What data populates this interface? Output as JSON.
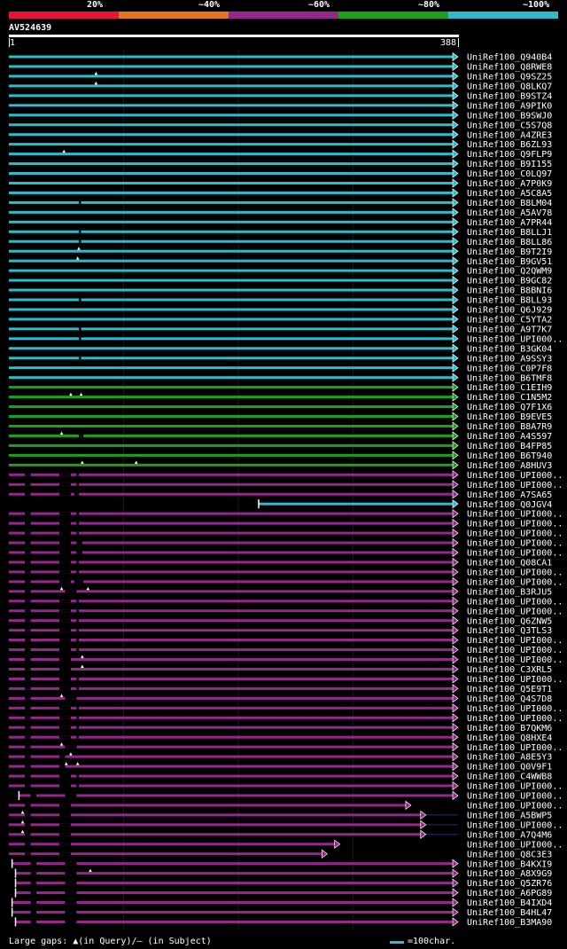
{
  "legend": {
    "segments": [
      {
        "color": "#e6143c"
      },
      {
        "color": "#e6731e"
      },
      {
        "color": "#96288c"
      },
      {
        "color": "#1ea01e"
      },
      {
        "color": "#2cbccc"
      }
    ],
    "labels": [
      "20%",
      "~40%",
      "~60%",
      "~80%",
      "~100%"
    ]
  },
  "query": {
    "name": "AV524639",
    "start": "1",
    "end": "388",
    "length": 388
  },
  "colors": {
    "cyan": "#2cbccc",
    "green": "#1ea01e",
    "purple": "#96288c",
    "query": "#ffffff",
    "insert": "#ffffc8"
  },
  "hits": [
    {
      "label": "UniRef100_Q940B4",
      "c": "cyan",
      "s": 1,
      "e": 388
    },
    {
      "label": "UniRef100_Q8RWE8",
      "c": "cyan",
      "s": 1,
      "e": 388
    },
    {
      "label": "UniRef100_Q9SZ25",
      "c": "cyan",
      "s": 1,
      "e": 388,
      "ins": [
        77
      ]
    },
    {
      "label": "UniRef100_Q8LKQ7",
      "c": "cyan",
      "s": 1,
      "e": 388,
      "ins": [
        77
      ]
    },
    {
      "label": "UniRef100_B9STZ4",
      "c": "cyan",
      "s": 1,
      "e": 388
    },
    {
      "label": "UniRef100_A9PIK0",
      "c": "cyan",
      "s": 1,
      "e": 388
    },
    {
      "label": "UniRef100_B9SWJ0",
      "c": "cyan",
      "s": 1,
      "e": 388
    },
    {
      "label": "UniRef100_C5S7Q8",
      "c": "cyan",
      "s": 1,
      "e": 388
    },
    {
      "label": "UniRef100_A4ZRE3",
      "c": "cyan",
      "s": 1,
      "e": 388
    },
    {
      "label": "UniRef100_B6ZL93",
      "c": "cyan",
      "s": 1,
      "e": 388
    },
    {
      "label": "UniRef100_Q9FLP9",
      "c": "cyan",
      "s": 1,
      "e": 388,
      "ins": [
        49
      ]
    },
    {
      "label": "UniRef100_B9I155",
      "c": "cyan",
      "s": 1,
      "e": 388
    },
    {
      "label": "UniRef100_C0LQ97",
      "c": "cyan",
      "s": 1,
      "e": 388
    },
    {
      "label": "UniRef100_A7P0K9",
      "c": "cyan",
      "s": 1,
      "e": 388
    },
    {
      "label": "UniRef100_A5C8A5",
      "c": "cyan",
      "s": 1,
      "e": 388
    },
    {
      "label": "UniRef100_B8LM04",
      "c": "cyan",
      "s": 1,
      "e": 388,
      "gaps": [
        [
          62,
          64
        ]
      ]
    },
    {
      "label": "UniRef100_A5AV78",
      "c": "cyan",
      "s": 1,
      "e": 388
    },
    {
      "label": "UniRef100_A7PR44",
      "c": "cyan",
      "s": 1,
      "e": 388
    },
    {
      "label": "UniRef100_B8LLJ1",
      "c": "cyan",
      "s": 1,
      "e": 388,
      "gaps": [
        [
          62,
          64
        ]
      ]
    },
    {
      "label": "UniRef100_B8LL86",
      "c": "cyan",
      "s": 1,
      "e": 388,
      "gaps": [
        [
          62,
          64
        ]
      ]
    },
    {
      "label": "UniRef100_B9T2I9",
      "c": "cyan",
      "s": 1,
      "e": 388,
      "ins": [
        62
      ]
    },
    {
      "label": "UniRef100_B9GV51",
      "c": "cyan",
      "s": 1,
      "e": 388,
      "ins": [
        61
      ]
    },
    {
      "label": "UniRef100_Q2QWM9",
      "c": "cyan",
      "s": 1,
      "e": 388
    },
    {
      "label": "UniRef100_B9GC82",
      "c": "cyan",
      "s": 1,
      "e": 388
    },
    {
      "label": "UniRef100_B8BNI6",
      "c": "cyan",
      "s": 1,
      "e": 388
    },
    {
      "label": "UniRef100_B8LL93",
      "c": "cyan",
      "s": 1,
      "e": 388,
      "gaps": [
        [
          62,
          64
        ]
      ]
    },
    {
      "label": "UniRef100_Q6J929",
      "c": "cyan",
      "s": 1,
      "e": 388
    },
    {
      "label": "UniRef100_C5YTA2",
      "c": "cyan",
      "s": 1,
      "e": 388
    },
    {
      "label": "UniRef100_A9T7K7",
      "c": "cyan",
      "s": 1,
      "e": 388,
      "gaps": [
        [
          62,
          64
        ]
      ]
    },
    {
      "label": "UniRef100_UPI000..",
      "c": "cyan",
      "s": 1,
      "e": 388,
      "gaps": [
        [
          62,
          64
        ]
      ]
    },
    {
      "label": "UniRef100_B3GK04",
      "c": "cyan",
      "s": 1,
      "e": 388
    },
    {
      "label": "UniRef100_A9SSY3",
      "c": "cyan",
      "s": 1,
      "e": 388,
      "gaps": [
        [
          62,
          64
        ]
      ]
    },
    {
      "label": "UniRef100_C0P7F8",
      "c": "cyan",
      "s": 1,
      "e": 388
    },
    {
      "label": "UniRef100_B6TMF8",
      "c": "cyan",
      "s": 1,
      "e": 388
    },
    {
      "label": "UniRef100_C1EIH9",
      "c": "green",
      "s": 1,
      "e": 388
    },
    {
      "label": "UniRef100_C1N5M2",
      "c": "green",
      "s": 1,
      "e": 388,
      "ins": [
        55,
        64
      ]
    },
    {
      "label": "UniRef100_Q7F1X6",
      "c": "green",
      "s": 1,
      "e": 388
    },
    {
      "label": "UniRef100_B9EVE5",
      "c": "green",
      "s": 1,
      "e": 388
    },
    {
      "label": "UniRef100_B8A7R9",
      "c": "green",
      "s": 1,
      "e": 388
    },
    {
      "label": "UniRef100_A4S597",
      "c": "green",
      "s": 1,
      "e": 388,
      "ins": [
        47
      ],
      "gaps": [
        [
          62,
          66
        ]
      ]
    },
    {
      "label": "UniRef100_B4FP85",
      "c": "green",
      "s": 1,
      "e": 388
    },
    {
      "label": "UniRef100_B6T940",
      "c": "green",
      "s": 1,
      "e": 388
    },
    {
      "label": "UniRef100_A8HUV3",
      "c": "green",
      "s": 1,
      "e": 388,
      "ins": [
        65,
        112
      ]
    },
    {
      "label": "UniRef100_UPI000..",
      "c": "purple",
      "s": 1,
      "e": 388,
      "gaps": [
        [
          15,
          20
        ],
        [
          45,
          55
        ],
        [
          60,
          62
        ]
      ]
    },
    {
      "label": "UniRef100_UPI000..",
      "c": "purple",
      "s": 1,
      "e": 388,
      "gaps": [
        [
          15,
          20
        ],
        [
          45,
          55
        ],
        [
          60,
          62
        ]
      ]
    },
    {
      "label": "UniRef100_A7SA65",
      "c": "purple",
      "s": 1,
      "e": 388,
      "gaps": [
        [
          15,
          20
        ],
        [
          45,
          55
        ],
        [
          58,
          62
        ]
      ]
    },
    {
      "label": "UniRef100_Q0JGV4",
      "c": "cyan",
      "s": 219,
      "e": 388,
      "tick": true
    },
    {
      "label": "UniRef100_UPI000..",
      "c": "purple",
      "s": 1,
      "e": 388,
      "gaps": [
        [
          15,
          20
        ],
        [
          45,
          55
        ],
        [
          60,
          62
        ]
      ]
    },
    {
      "label": "UniRef100_UPI000..",
      "c": "purple",
      "s": 1,
      "e": 388,
      "gaps": [
        [
          15,
          20
        ],
        [
          45,
          55
        ],
        [
          60,
          62
        ]
      ]
    },
    {
      "label": "UniRef100_UPI000..",
      "c": "purple",
      "s": 1,
      "e": 388,
      "gaps": [
        [
          15,
          20
        ],
        [
          45,
          55
        ],
        [
          60,
          62
        ]
      ]
    },
    {
      "label": "UniRef100_UPI000..",
      "c": "purple",
      "s": 1,
      "e": 388,
      "gaps": [
        [
          15,
          20
        ],
        [
          45,
          55
        ],
        [
          60,
          65
        ]
      ]
    },
    {
      "label": "UniRef100_UPI000..",
      "c": "purple",
      "s": 1,
      "e": 388,
      "gaps": [
        [
          15,
          20
        ],
        [
          45,
          55
        ],
        [
          60,
          65
        ]
      ]
    },
    {
      "label": "UniRef100_Q08CA1",
      "c": "purple",
      "s": 1,
      "e": 388,
      "gaps": [
        [
          15,
          20
        ],
        [
          45,
          55
        ],
        [
          60,
          62
        ]
      ]
    },
    {
      "label": "UniRef100_UPI000..",
      "c": "purple",
      "s": 1,
      "e": 388,
      "gaps": [
        [
          15,
          20
        ],
        [
          45,
          55
        ],
        [
          60,
          62
        ]
      ]
    },
    {
      "label": "UniRef100_UPI000..",
      "c": "purple",
      "s": 1,
      "e": 388,
      "gaps": [
        [
          15,
          20
        ],
        [
          45,
          55
        ],
        [
          58,
          66
        ]
      ]
    },
    {
      "label": "UniRef100_B3RJU5",
      "c": "purple",
      "s": 1,
      "e": 388,
      "ins": [
        47,
        70
      ],
      "gaps": [
        [
          15,
          20
        ],
        [
          50,
          60
        ]
      ]
    },
    {
      "label": "UniRef100_UPI000..",
      "c": "purple",
      "s": 1,
      "e": 388,
      "gaps": [
        [
          15,
          20
        ],
        [
          45,
          55
        ],
        [
          60,
          62
        ]
      ]
    },
    {
      "label": "UniRef100_UPI000..",
      "c": "purple",
      "s": 1,
      "e": 388,
      "gaps": [
        [
          15,
          20
        ],
        [
          45,
          55
        ],
        [
          60,
          62
        ]
      ]
    },
    {
      "label": "UniRef100_Q6ZNW5",
      "c": "purple",
      "s": 1,
      "e": 388,
      "gaps": [
        [
          15,
          20
        ],
        [
          45,
          55
        ],
        [
          60,
          62
        ]
      ]
    },
    {
      "label": "UniRef100_Q3TLS3",
      "c": "purple",
      "s": 1,
      "e": 388,
      "gaps": [
        [
          15,
          20
        ],
        [
          45,
          55
        ],
        [
          60,
          62
        ]
      ]
    },
    {
      "label": "UniRef100_UPI000..",
      "c": "purple",
      "s": 1,
      "e": 388,
      "gaps": [
        [
          15,
          20
        ],
        [
          45,
          55
        ],
        [
          60,
          62
        ]
      ]
    },
    {
      "label": "UniRef100_UPI000..",
      "c": "purple",
      "s": 1,
      "e": 388,
      "gaps": [
        [
          15,
          20
        ],
        [
          45,
          55
        ],
        [
          60,
          62
        ]
      ]
    },
    {
      "label": "UniRef100_UPI000..",
      "c": "purple",
      "s": 1,
      "e": 388,
      "ins": [
        65
      ],
      "gaps": [
        [
          15,
          20
        ],
        [
          45,
          55
        ]
      ]
    },
    {
      "label": "UniRef100_C3XRL5",
      "c": "purple",
      "s": 1,
      "e": 388,
      "ins": [
        65
      ],
      "gaps": [
        [
          15,
          20
        ],
        [
          45,
          55
        ]
      ]
    },
    {
      "label": "UniRef100_UPI000..",
      "c": "purple",
      "s": 1,
      "e": 388,
      "gaps": [
        [
          15,
          20
        ],
        [
          45,
          55
        ],
        [
          60,
          62
        ]
      ]
    },
    {
      "label": "UniRef100_Q5E9T1",
      "c": "purple",
      "s": 1,
      "e": 388,
      "gaps": [
        [
          15,
          20
        ],
        [
          45,
          55
        ],
        [
          60,
          62
        ]
      ]
    },
    {
      "label": "UniRef100_Q4S7D8",
      "c": "purple",
      "s": 1,
      "e": 388,
      "ins": [
        47
      ],
      "gaps": [
        [
          15,
          20
        ],
        [
          50,
          60
        ]
      ]
    },
    {
      "label": "UniRef100_UPI000..",
      "c": "purple",
      "s": 1,
      "e": 388,
      "gaps": [
        [
          15,
          20
        ],
        [
          45,
          55
        ],
        [
          60,
          62
        ]
      ]
    },
    {
      "label": "UniRef100_UPI000..",
      "c": "purple",
      "s": 1,
      "e": 388,
      "gaps": [
        [
          15,
          20
        ],
        [
          45,
          55
        ],
        [
          60,
          62
        ]
      ]
    },
    {
      "label": "UniRef100_B7QKM6",
      "c": "purple",
      "s": 1,
      "e": 388,
      "gaps": [
        [
          15,
          20
        ],
        [
          45,
          55
        ],
        [
          60,
          62
        ]
      ]
    },
    {
      "label": "UniRef100_Q8HXE4",
      "c": "purple",
      "s": 1,
      "e": 388,
      "gaps": [
        [
          15,
          20
        ],
        [
          45,
          55
        ],
        [
          60,
          62
        ]
      ]
    },
    {
      "label": "UniRef100_UPI000..",
      "c": "purple",
      "s": 1,
      "e": 388,
      "ins": [
        47
      ],
      "gaps": [
        [
          15,
          20
        ],
        [
          50,
          60
        ]
      ]
    },
    {
      "label": "UniRef100_A8E5Y3",
      "c": "purple",
      "s": 1,
      "e": 388,
      "ins": [
        55
      ],
      "gaps": [
        [
          15,
          20
        ],
        [
          45,
          50
        ]
      ]
    },
    {
      "label": "UniRef100_Q0V9F1",
      "c": "purple",
      "s": 1,
      "e": 388,
      "ins": [
        51,
        61
      ],
      "gaps": [
        [
          15,
          20
        ],
        [
          45,
          50
        ]
      ]
    },
    {
      "label": "UniRef100_C4WWB8",
      "c": "purple",
      "s": 1,
      "e": 388,
      "gaps": [
        [
          15,
          20
        ],
        [
          45,
          55
        ],
        [
          60,
          62
        ]
      ]
    },
    {
      "label": "UniRef100_UPI000..",
      "c": "purple",
      "s": 1,
      "e": 388,
      "gaps": [
        [
          15,
          20
        ],
        [
          45,
          55
        ],
        [
          60,
          62
        ]
      ]
    },
    {
      "label": "UniRef100_UPI000..",
      "c": "purple",
      "s": 10,
      "e": 388,
      "tick": true,
      "gaps": [
        [
          20,
          25
        ],
        [
          50,
          60
        ]
      ]
    },
    {
      "label": "UniRef100_UPI000..",
      "c": "purple",
      "s": 1,
      "e": 347,
      "gaps": [
        [
          15,
          20
        ],
        [
          45,
          55
        ]
      ]
    },
    {
      "label": "UniRef100_A5BWP5",
      "c": "purple",
      "s": 1,
      "e": 360,
      "tail": 388,
      "ins": [
        13
      ],
      "gaps": [
        [
          15,
          20
        ],
        [
          45,
          55
        ]
      ]
    },
    {
      "label": "UniRef100_UPI000..",
      "c": "purple",
      "s": 1,
      "e": 360,
      "tail": 388,
      "ins": [
        13
      ],
      "gaps": [
        [
          15,
          20
        ],
        [
          45,
          55
        ]
      ]
    },
    {
      "label": "UniRef100_A7Q4M6",
      "c": "purple",
      "s": 1,
      "e": 360,
      "tail": 388,
      "ins": [
        13
      ],
      "gaps": [
        [
          15,
          20
        ],
        [
          45,
          55
        ]
      ]
    },
    {
      "label": "UniRef100_UPI000..",
      "c": "purple",
      "s": 1,
      "e": 285,
      "gaps": [
        [
          15,
          20
        ],
        [
          45,
          55
        ]
      ]
    },
    {
      "label": "UniRef100_Q8C3E3",
      "c": "purple",
      "s": 1,
      "e": 274,
      "gaps": [
        [
          15,
          20
        ],
        [
          45,
          55
        ]
      ]
    },
    {
      "label": "UniRef100_B4KXI9",
      "c": "purple",
      "s": 4,
      "e": 388,
      "tick": true,
      "gaps": [
        [
          20,
          25
        ],
        [
          50,
          60
        ]
      ]
    },
    {
      "label": "UniRef100_A8X9G9",
      "c": "purple",
      "s": 7,
      "e": 388,
      "tick": true,
      "ins": [
        72
      ],
      "gaps": [
        [
          20,
          25
        ],
        [
          50,
          60
        ]
      ]
    },
    {
      "label": "UniRef100_Q5ZR76",
      "c": "purple",
      "s": 7,
      "e": 388,
      "tick": true,
      "gaps": [
        [
          20,
          25
        ],
        [
          50,
          60
        ]
      ]
    },
    {
      "label": "UniRef100_A6PG89",
      "c": "purple",
      "s": 7,
      "e": 388,
      "tick": true,
      "gaps": [
        [
          20,
          25
        ],
        [
          50,
          60
        ]
      ]
    },
    {
      "label": "UniRef100_B4IXD4",
      "c": "purple",
      "s": 4,
      "e": 388,
      "tick": true,
      "gaps": [
        [
          20,
          25
        ],
        [
          50,
          60
        ]
      ]
    },
    {
      "label": "UniRef100_B4HL47",
      "c": "purple",
      "s": 4,
      "e": 388,
      "tick": true,
      "gaps": [
        [
          20,
          25
        ],
        [
          50,
          60
        ]
      ]
    },
    {
      "label": "UniRef100_B3MA90",
      "c": "purple",
      "s": 7,
      "e": 388,
      "tick": true,
      "gaps": [
        [
          20,
          25
        ],
        [
          50,
          60
        ]
      ]
    }
  ],
  "footer": {
    "left": "Large gaps: ▲(in Query)/– (in Subject)",
    "right": "=100char."
  }
}
